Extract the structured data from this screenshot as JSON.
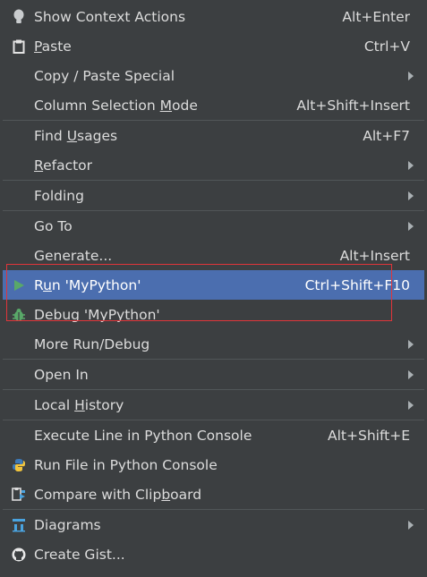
{
  "menu": {
    "items": [
      {
        "pre": "Show Context Actions",
        "mn": "",
        "post": "",
        "shortcut": "Alt+Enter",
        "icon": "bulb-icon",
        "submenu": false
      },
      {
        "pre": "",
        "mn": "P",
        "post": "aste",
        "shortcut": "Ctrl+V",
        "icon": "clipboard-icon",
        "submenu": false
      },
      {
        "pre": "Copy / Paste Special",
        "mn": "",
        "post": "",
        "shortcut": "",
        "icon": "",
        "submenu": true
      },
      {
        "pre": "Column Selection ",
        "mn": "M",
        "post": "ode",
        "shortcut": "Alt+Shift+Insert",
        "icon": "",
        "submenu": false
      },
      {
        "pre": "Find ",
        "mn": "U",
        "post": "sages",
        "shortcut": "Alt+F7",
        "icon": "",
        "submenu": false
      },
      {
        "pre": "",
        "mn": "R",
        "post": "efactor",
        "shortcut": "",
        "icon": "",
        "submenu": true
      },
      {
        "pre": "Folding",
        "mn": "",
        "post": "",
        "shortcut": "",
        "icon": "",
        "submenu": true
      },
      {
        "pre": "Go To",
        "mn": "",
        "post": "",
        "shortcut": "",
        "icon": "",
        "submenu": true
      },
      {
        "pre": "Generate...",
        "mn": "",
        "post": "",
        "shortcut": "Alt+Insert",
        "icon": "",
        "submenu": false
      },
      {
        "pre": "R",
        "mn": "u",
        "post": "n 'MyPython'",
        "shortcut": "Ctrl+Shift+F10",
        "icon": "run-icon",
        "submenu": false
      },
      {
        "pre": "",
        "mn": "D",
        "post": "ebug 'MyPython'",
        "shortcut": "",
        "icon": "debug-icon",
        "submenu": false
      },
      {
        "pre": "More Run/Debug",
        "mn": "",
        "post": "",
        "shortcut": "",
        "icon": "",
        "submenu": true
      },
      {
        "pre": "Open In",
        "mn": "",
        "post": "",
        "shortcut": "",
        "icon": "",
        "submenu": true
      },
      {
        "pre": "Local ",
        "mn": "H",
        "post": "istory",
        "shortcut": "",
        "icon": "",
        "submenu": true
      },
      {
        "pre": "Execute Line in Python Console",
        "mn": "",
        "post": "",
        "shortcut": "Alt+Shift+E",
        "icon": "",
        "submenu": false
      },
      {
        "pre": "Run File in Python Console",
        "mn": "",
        "post": "",
        "shortcut": "",
        "icon": "python-icon",
        "submenu": false
      },
      {
        "pre": "Compare with Clip",
        "mn": "b",
        "post": "oard",
        "shortcut": "",
        "icon": "compare-icon",
        "submenu": false
      },
      {
        "pre": "Diagrams",
        "mn": "",
        "post": "",
        "shortcut": "",
        "icon": "diagram-icon",
        "submenu": true
      },
      {
        "pre": "Create Gist...",
        "mn": "",
        "post": "",
        "shortcut": "",
        "icon": "github-icon",
        "submenu": false
      }
    ],
    "colors": {
      "background": "#3c3f41",
      "selection": "#4b6eaf",
      "text": "#dcdcdc",
      "separator": "#515658",
      "highlight_box": "#e0353a"
    }
  }
}
